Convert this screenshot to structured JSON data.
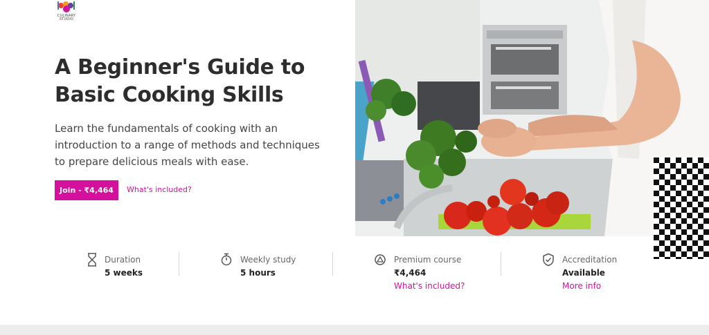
{
  "brand": {
    "logo_text": "CULINARY STUDIO",
    "accent_color": "#d4109d"
  },
  "hero": {
    "title": "A Beginner's Guide to Basic Cooking Skills",
    "description": "Learn the fundamentals of cooking with an introduction to a range of methods and techniques to prepare delicious meals with ease.",
    "join_button": "Join - ₹4,464",
    "included_link": "What's included?"
  },
  "stats": [
    {
      "icon": "hourglass-icon",
      "label": "Duration",
      "value": "5 weeks"
    },
    {
      "icon": "stopwatch-icon",
      "label": "Weekly study",
      "value": "5 hours"
    },
    {
      "icon": "premium-badge-icon",
      "label": "Premium course",
      "value": "₹4,464",
      "link": "What's included?"
    },
    {
      "icon": "shield-check-icon",
      "label": "Accreditation",
      "value": "Available",
      "link": "More info"
    }
  ]
}
